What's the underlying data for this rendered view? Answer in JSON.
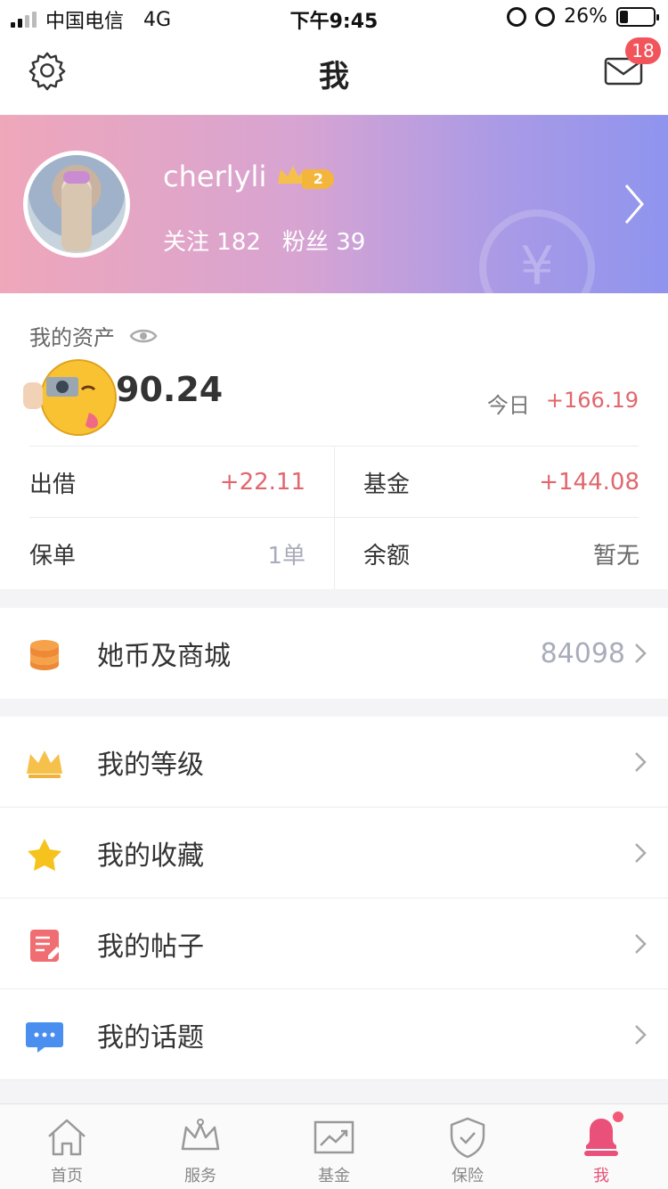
{
  "status_bar": {
    "carrier": "中国电信",
    "network": "4G",
    "time": "下午9:45",
    "battery": "26%",
    "battery_level": 0.26
  },
  "header": {
    "title": "我",
    "settings_icon": "gear-icon",
    "mail_icon": "mail-icon",
    "mail_badge": "18"
  },
  "profile": {
    "username": "cherlyli",
    "level": "2",
    "following_label": "关注",
    "following_count": "182",
    "fans_label": "粉丝",
    "fans_count": "39",
    "currency_glyph": "¥"
  },
  "assets": {
    "label": "我的资产",
    "total_partial": "90.24",
    "today_label": "今日",
    "today_value": "+166.19",
    "cells": [
      {
        "key": "出借",
        "value": "+22.11"
      },
      {
        "key": "基金",
        "value": "+144.08"
      },
      {
        "key": "保单",
        "value": "1单"
      },
      {
        "key": "余额",
        "value": "暂无"
      }
    ]
  },
  "coins": {
    "label": "她币及商城",
    "value": "84098"
  },
  "menu": [
    {
      "label": "我的等级",
      "icon": "crown-icon"
    },
    {
      "label": "我的收藏",
      "icon": "star-icon"
    },
    {
      "label": "我的帖子",
      "icon": "post-icon"
    },
    {
      "label": "我的话题",
      "icon": "topic-icon"
    }
  ],
  "tabbar": [
    {
      "label": "首页",
      "icon": "home-icon"
    },
    {
      "label": "服务",
      "icon": "crown-outline-icon"
    },
    {
      "label": "基金",
      "icon": "chart-icon"
    },
    {
      "label": "保险",
      "icon": "shield-icon"
    },
    {
      "label": "我",
      "icon": "user-icon",
      "active": true
    }
  ],
  "colors": {
    "accent": "#e9517a",
    "positive": "#e0676d",
    "banner_start": "#efa7ba",
    "banner_end": "#8f94ee"
  }
}
